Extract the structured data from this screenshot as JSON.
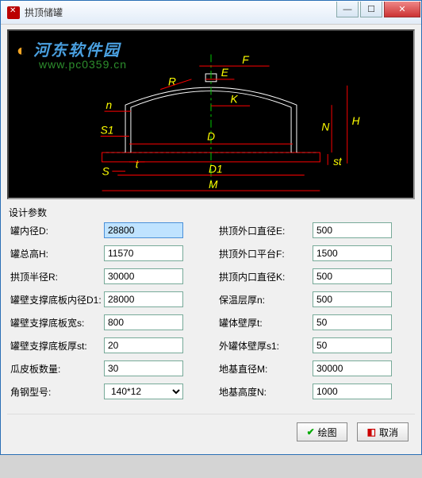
{
  "window": {
    "title": "拱顶储罐"
  },
  "watermark": {
    "text1": "河东软件园",
    "text2": "www.pc0359.cn"
  },
  "section_label": "设计参数",
  "diagram_labels": {
    "F": "F",
    "E": "E",
    "R": "R",
    "n": "n",
    "S1": "S1",
    "K": "K",
    "D": "D",
    "N": "N",
    "H": "H",
    "S": "S",
    "t": "t",
    "D1": "D1",
    "st": "st",
    "M": "M"
  },
  "fields": {
    "r1": {
      "label": "罐内径D:",
      "value": "28800"
    },
    "r2": {
      "label": "拱顶外口直径E:",
      "value": "500"
    },
    "r3": {
      "label": "罐总高H:",
      "value": "11570"
    },
    "r4": {
      "label": "拱顶外口平台F:",
      "value": "1500"
    },
    "r5": {
      "label": "拱顶半径R:",
      "value": "30000"
    },
    "r6": {
      "label": "拱顶内口直径K:",
      "value": "500"
    },
    "r7": {
      "label": "罐壁支撑底板内径D1:",
      "value": "28000"
    },
    "r8": {
      "label": "保温层厚n:",
      "value": "500"
    },
    "r9": {
      "label": "罐壁支撑底板宽s:",
      "value": "800"
    },
    "r10": {
      "label": "罐体壁厚t:",
      "value": "50"
    },
    "r11": {
      "label": "罐壁支撑底板厚st:",
      "value": "20"
    },
    "r12": {
      "label": "外罐体壁厚s1:",
      "value": "50"
    },
    "r13": {
      "label": "瓜皮板数量:",
      "value": "30"
    },
    "r14": {
      "label": "地基直径M:",
      "value": "30000"
    },
    "r15": {
      "label": "角钢型号:",
      "value": "140*12"
    },
    "r16": {
      "label": "地基高度N:",
      "value": "1000"
    }
  },
  "buttons": {
    "draw": "绘图",
    "cancel": "取消"
  }
}
